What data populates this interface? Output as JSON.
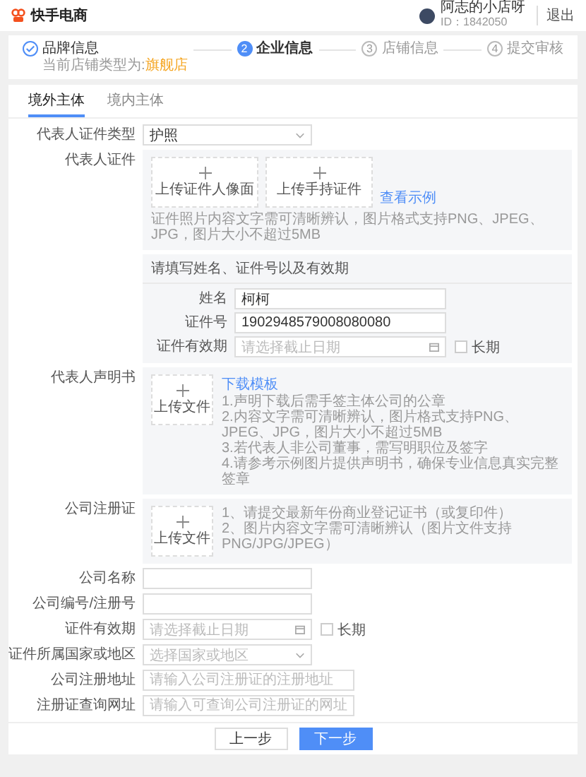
{
  "header": {
    "logo": "快手电商",
    "user_name": "阿志的小店呀",
    "user_id": "ID：1842050",
    "logout": "退出"
  },
  "steps": [
    {
      "title": "品牌信息",
      "subtitle": "当前店铺类型为:",
      "highlight": "旗舰店",
      "completed": true,
      "selected": false
    },
    {
      "number": "2",
      "title": "企业信息",
      "completed": false,
      "selected": true
    },
    {
      "number": "3",
      "title": "店铺信息",
      "completed": false,
      "selected": false
    },
    {
      "number": "4",
      "title": "提交审核",
      "completed": false,
      "selected": false
    }
  ],
  "tabs": [
    {
      "label": "境外主体",
      "selected": true
    },
    {
      "label": "境内主体",
      "selected": false
    }
  ],
  "rows": [
    {
      "kind": "select",
      "label": "代表人证件类型",
      "value": "护照"
    },
    {
      "kind": "upload",
      "label": "代表人证件",
      "slots": [
        "上传证件人像面",
        "上传手持证件"
      ],
      "link": "查看示例",
      "hints": [
        "证件照片内容文字需可清晰辨认，图片格式支持PNG、JPEG、JPG，图片大小不超过5MB"
      ]
    },
    {
      "kind": "identity",
      "title": "请填写姓名、证件号以及有效期",
      "fields": [
        {
          "kind": "input",
          "label": "姓名",
          "value": "柯柯"
        },
        {
          "kind": "input",
          "label": "证件号",
          "value": "1902948579008080080"
        },
        {
          "kind": "date",
          "label": "证件有效期",
          "placeholder": "请选择截止日期",
          "checkbox": {
            "label": "长期",
            "checked": false
          }
        }
      ]
    },
    {
      "kind": "upload",
      "label": "代表人声明书",
      "slots": [
        "上传文件"
      ],
      "link": "下载模板",
      "hints": [
        "1.声明下载后需手签主体公司的公章",
        "2.内容文字需可清晰辨认，图片格式支持PNG、JPEG、JPG，图片大小不超过5MB",
        "3.若代表人非公司董事，需写明职位及签字",
        "4.请参考示例图片提供声明书，确保专业信息真实完整签章"
      ]
    },
    {
      "kind": "upload",
      "label": "公司注册证",
      "slots": [
        "上传文件"
      ],
      "hints": [
        "1、请提交最新年份商业登记证书（或复印件）",
        "2、图片内容文字需可清晰辨认（图片文件支持PNG/JPG/JPEG）"
      ]
    },
    {
      "kind": "input",
      "label": "公司名称"
    },
    {
      "kind": "input",
      "label": "公司编号/注册号"
    },
    {
      "kind": "date",
      "label": "证件有效期",
      "placeholder": "请选择截止日期",
      "checkbox": {
        "label": "长期",
        "checked": false
      }
    },
    {
      "kind": "select",
      "label": "证件所属国家或地区",
      "placeholder": "选择国家或地区"
    },
    {
      "kind": "input",
      "label": "公司注册地址",
      "placeholder": "请输入公司注册证的注册地址"
    },
    {
      "kind": "input",
      "label": "注册证查询网址",
      "placeholder": "请输入可查询公司注册证的网址"
    }
  ],
  "buttons": [
    {
      "label": "上一步",
      "primary": false
    },
    {
      "label": "下一步",
      "primary": true
    }
  ]
}
